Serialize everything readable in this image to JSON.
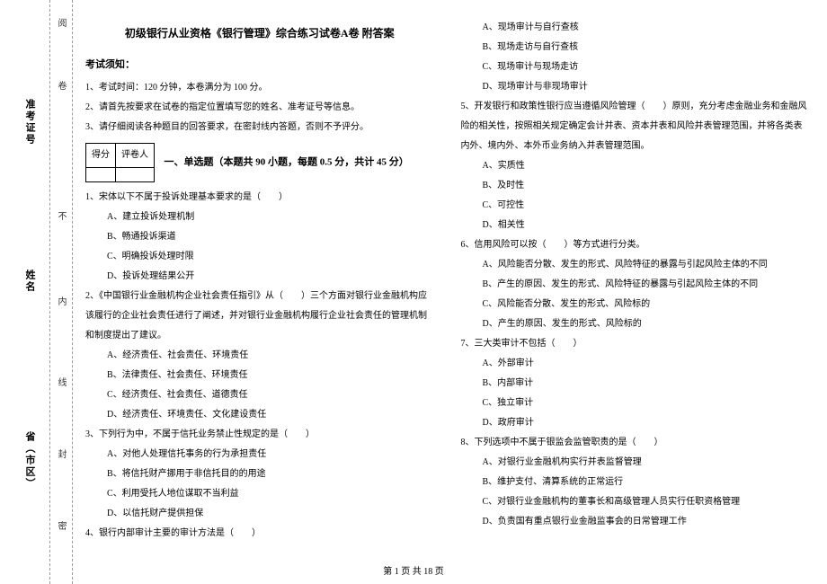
{
  "sidebar": {
    "dash_labels": [
      "阅",
      "卷",
      "不",
      "内",
      "线",
      "封",
      "密"
    ],
    "fields": [
      "准考证号",
      "姓名",
      "省（市区）"
    ]
  },
  "title": "初级银行从业资格《银行管理》综合练习试卷A卷 附答案",
  "notice_head": "考试须知：",
  "notices": [
    "1、考试时间：120 分钟，本卷满分为 100 分。",
    "2、请首先按要求在试卷的指定位置填写您的姓名、准考证号等信息。",
    "3、请仔细阅读各种题目的回答要求，在密封线内答题，否则不予评分。"
  ],
  "score_labels": {
    "score": "得分",
    "grader": "评卷人"
  },
  "part1_title": "一、单选题（本题共 90 小题，每题 0.5 分，共计 45 分）",
  "left_questions": [
    {
      "stem": "1、宋体以下不属于投诉处理基本要求的是（　　）",
      "opts": [
        "A、建立投诉处理机制",
        "B、畅通投诉渠道",
        "C、明确投诉处理时限",
        "D、投诉处理结果公开"
      ]
    },
    {
      "stem": "2、《中国银行业金融机构企业社会责任指引》从（　　）三个方面对银行业金融机构应该履行的企业社会责任进行了阐述，并对银行业金融机构履行企业社会责任的管理机制和制度提出了建议。",
      "opts": [
        "A、经济责任、社会责任、环境责任",
        "B、法律责任、社会责任、环境责任",
        "C、经济责任、社会责任、道德责任",
        "D、经济责任、环境责任、文化建设责任"
      ]
    },
    {
      "stem": "3、下列行为中，不属于信托业务禁止性规定的是（　　）",
      "opts": [
        "A、对他人处理信托事务的行为承担责任",
        "B、将信托财产挪用于非信托目的的用途",
        "C、利用受托人地位谋取不当利益",
        "D、以信托财产提供担保"
      ]
    },
    {
      "stem": "4、银行内部审计主要的审计方法是（　　）",
      "opts": []
    }
  ],
  "right_items": [
    {
      "type": "opt",
      "text": "A、现场审计与自行查核"
    },
    {
      "type": "opt",
      "text": "B、现场走访与自行查核"
    },
    {
      "type": "opt",
      "text": "C、现场审计与现场走访"
    },
    {
      "type": "opt",
      "text": "D、现场审计与非现场审计"
    },
    {
      "type": "stem",
      "text": "5、开发银行和政策性银行应当遵循风险管理（　　）原则，充分考虑金融业务和金融风险的相关性，按照相关规定确定会计并表、资本并表和风险并表管理范围，并将各类表内外、境内外、本外币业务纳入并表管理范围。"
    },
    {
      "type": "opt",
      "text": "A、实质性"
    },
    {
      "type": "opt",
      "text": "B、及时性"
    },
    {
      "type": "opt",
      "text": "C、可控性"
    },
    {
      "type": "opt",
      "text": "D、相关性"
    },
    {
      "type": "stem",
      "text": "6、信用风险可以按（　　）等方式进行分类。"
    },
    {
      "type": "opt",
      "text": "A、风险能否分散、发生的形式、风险特征的暴露与引起风险主体的不同"
    },
    {
      "type": "opt",
      "text": "B、产生的原因、发生的形式、风险特征的暴露与引起风险主体的不同"
    },
    {
      "type": "opt",
      "text": "C、风险能否分散、发生的形式、风险标的"
    },
    {
      "type": "opt",
      "text": "D、产生的原因、发生的形式、风险标的"
    },
    {
      "type": "stem",
      "text": "7、三大类审计不包括（　　）"
    },
    {
      "type": "opt",
      "text": "A、外部审计"
    },
    {
      "type": "opt",
      "text": "B、内部审计"
    },
    {
      "type": "opt",
      "text": "C、独立审计"
    },
    {
      "type": "opt",
      "text": "D、政府审计"
    },
    {
      "type": "stem",
      "text": "8、下列选项中不属于银监会监管职责的是（　　）"
    },
    {
      "type": "opt",
      "text": "A、对银行业金融机构实行并表监督管理"
    },
    {
      "type": "opt",
      "text": "B、维护支付、清算系统的正常运行"
    },
    {
      "type": "opt",
      "text": "C、对银行业金融机构的董事长和高级管理人员实行任职资格管理"
    },
    {
      "type": "opt",
      "text": "D、负责国有重点银行业金融监事会的日常管理工作"
    }
  ],
  "footer": "第 1 页 共 18 页"
}
